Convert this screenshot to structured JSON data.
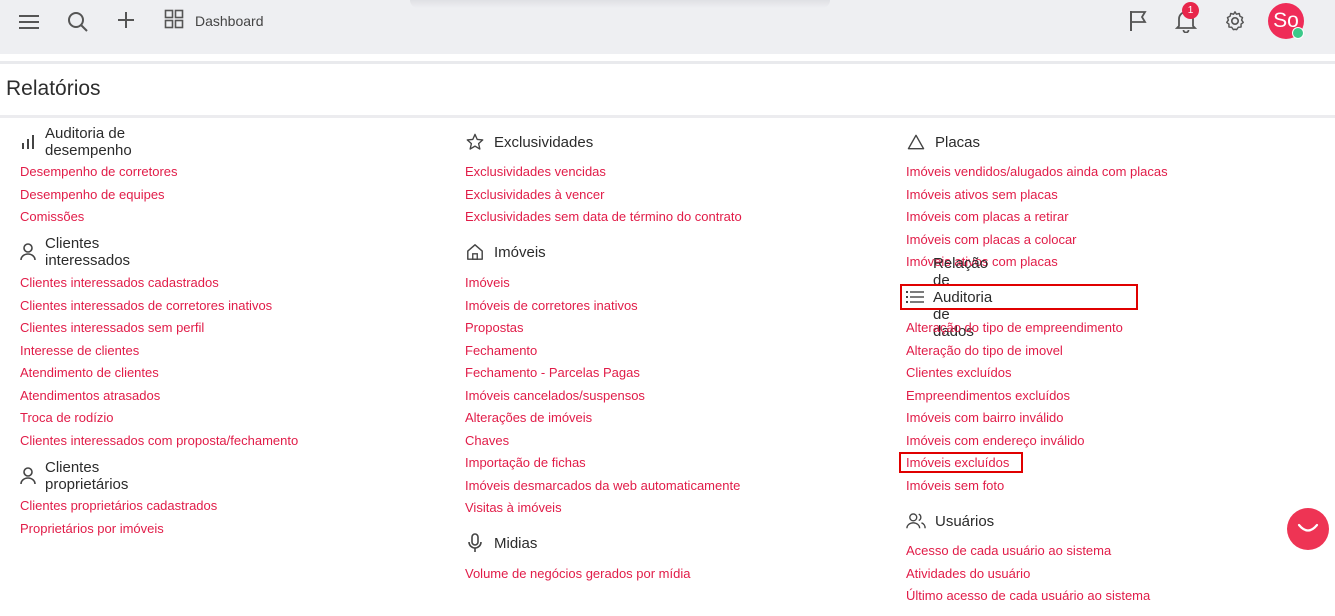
{
  "header": {
    "dashboard_label": "Dashboard",
    "notification_count": "1",
    "avatar_initials": "So",
    "icons": [
      "menu-icon",
      "search-icon",
      "plus-icon",
      "dashboard-grid-icon",
      "flag-icon",
      "bell-icon",
      "gear-icon"
    ]
  },
  "page": {
    "title": "Relatórios"
  },
  "columns": [
    {
      "sections": [
        {
          "title": "Auditoria de desempenho",
          "icon": "bar-chart-icon",
          "links": [
            "Desempenho de corretores",
            "Desempenho de equipes",
            "Comissões"
          ]
        },
        {
          "title": "Clientes interessados",
          "icon": "user-icon",
          "links": [
            "Clientes interessados cadastrados",
            "Clientes interessados de corretores inativos",
            "Clientes interessados sem perfil",
            "Interesse de clientes",
            "Atendimento de clientes",
            "Atendimentos atrasados",
            "Troca de rodízio",
            "Clientes interessados com proposta/fechamento"
          ]
        },
        {
          "title": "Clientes proprietários",
          "icon": "user-icon",
          "links": [
            "Clientes proprietários cadastrados",
            "Proprietários por imóveis"
          ]
        }
      ]
    },
    {
      "sections": [
        {
          "title": "Exclusividades",
          "icon": "star-icon",
          "links": [
            "Exclusividades vencidas",
            "Exclusividades à vencer",
            "Exclusividades sem data de término do contrato"
          ]
        },
        {
          "title": "Imóveis",
          "icon": "home-icon",
          "links": [
            "Imóveis",
            "Imóveis de corretores inativos",
            "Propostas",
            "Fechamento",
            "Fechamento - Parcelas Pagas",
            "Imóveis cancelados/suspensos",
            "Alterações de imóveis",
            "Chaves",
            "Importação de fichas",
            "Imóveis desmarcados da web automaticamente",
            "Visitas à imóveis"
          ]
        },
        {
          "title": "Midias",
          "icon": "microphone-icon",
          "links": [
            "Volume de negócios gerados por mídia"
          ]
        }
      ]
    },
    {
      "sections": [
        {
          "title": "Placas",
          "icon": "triangle-icon",
          "links": [
            "Imóveis vendidos/alugados ainda com placas",
            "Imóveis ativos sem placas",
            "Imóveis com placas a retirar",
            "Imóveis com placas a colocar",
            "Imóveis ativos com placas"
          ]
        },
        {
          "title": "Relação de Auditoria de dados",
          "icon": "list-icon",
          "links": [
            "Alteração do tipo de empreendimento",
            "Alteração do tipo de imovel",
            "Clientes excluídos",
            "Empreendimentos excluídos",
            "Imóveis com bairro inválido",
            "Imóveis com endereço inválido",
            "Imóveis excluídos",
            "Imóveis sem foto"
          ]
        },
        {
          "title": "Usuários",
          "icon": "users-icon",
          "links": [
            "Acesso de cada usuário ao sistema",
            "Atividades do usuário",
            "Último acesso de cada usuário ao sistema"
          ]
        }
      ]
    }
  ],
  "colors": {
    "link": "#e11c48",
    "accent": "#ef2c58",
    "highlight": "#e00000"
  }
}
